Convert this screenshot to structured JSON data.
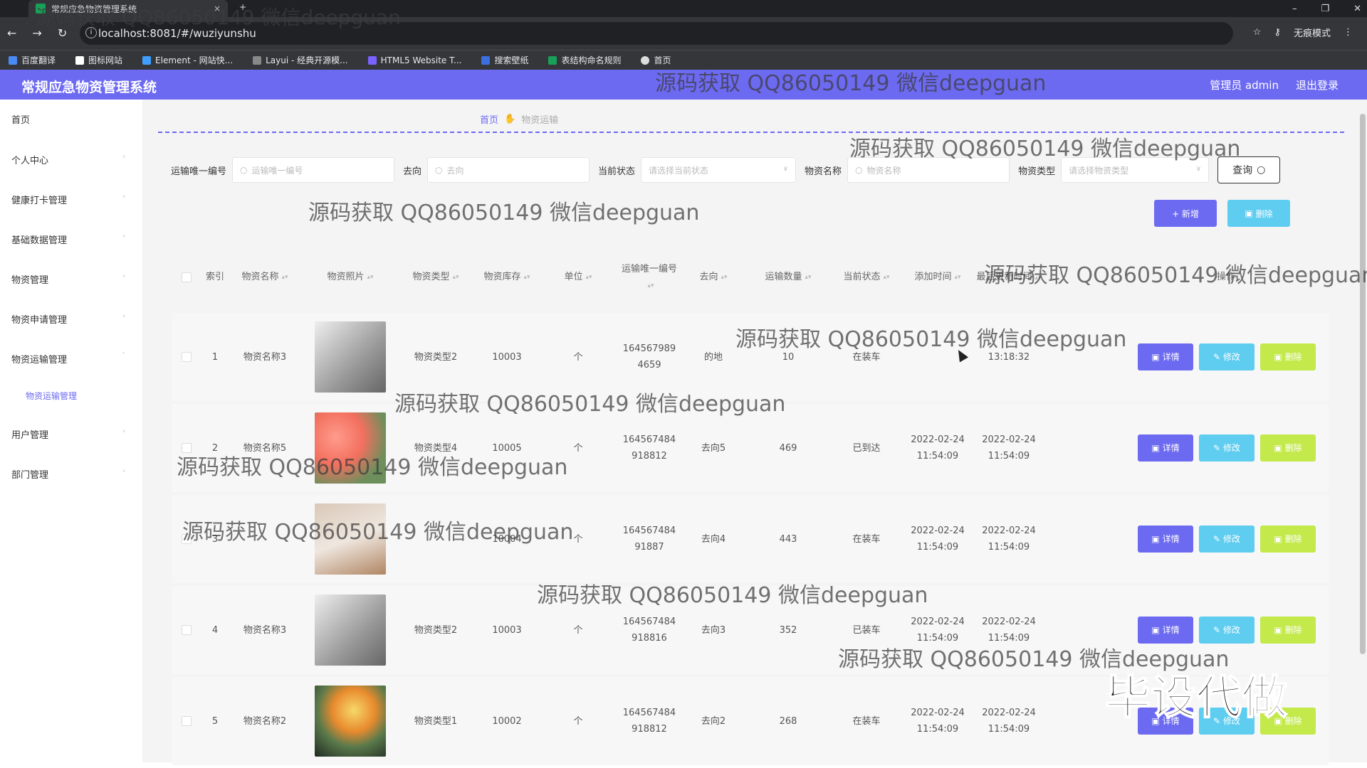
{
  "browser": {
    "tab_title": "常规应急物资管理系统",
    "tab_close": "×",
    "new_tab": "+",
    "url": "localhost:8081/#/wuziyunshu",
    "profile": "无痕模式",
    "bookmarks": [
      "百度翻译",
      "图标网站",
      "Element - 网站快...",
      "Layui - 经典开源模...",
      "HTML5 Website T...",
      "搜索壁纸",
      "表结构命名规则",
      "首页"
    ]
  },
  "header": {
    "title": "常规应急物资管理系统",
    "user": "管理员 admin",
    "logout": "退出登录"
  },
  "sidebar": {
    "items": [
      "首页",
      "个人中心",
      "健康打卡管理",
      "基础数据管理",
      "物资管理",
      "物资申请管理",
      "物资运输管理",
      "用户管理",
      "部门管理"
    ],
    "sub_item": "物资运输管理"
  },
  "breadcrumb": {
    "home": "首页",
    "current": "物资运输"
  },
  "filters": {
    "f1_label": "运输唯一编号",
    "f1_placeholder": "运输唯一编号",
    "f2_label": "去向",
    "f2_placeholder": "去向",
    "f3_label": "当前状态",
    "f3_placeholder": "请选择当前状态",
    "f4_label": "物资名称",
    "f4_placeholder": "物资名称",
    "f5_label": "物资类型",
    "f5_placeholder": "请选择物资类型",
    "query": "查询"
  },
  "actions": {
    "add": "+ 新增",
    "delete": "删除"
  },
  "table": {
    "headers": [
      "索引",
      "物资名称",
      "物资照片",
      "物资类型",
      "物资库存",
      "单位",
      "运输唯一编号",
      "去向",
      "运输数量",
      "当前状态",
      "添加时间",
      "最后更新时间",
      "操作"
    ],
    "row_buttons": {
      "detail": "详情",
      "edit": "修改",
      "delete": "删除"
    },
    "rows": [
      {
        "idx": "1",
        "name": "物资名称3",
        "type": "物资类型2",
        "stock": "10003",
        "unit": "个",
        "no": "164567989 4659",
        "dest": "的地",
        "qty": "10",
        "status": "在装车",
        "added": "",
        "updated": "13:18:32",
        "photo": "ph-1"
      },
      {
        "idx": "2",
        "name": "物资名称5",
        "type": "物资类型4",
        "stock": "10005",
        "unit": "个",
        "no": "164567484 918812",
        "dest": "去向5",
        "qty": "469",
        "status": "已到达",
        "added": "2022-02-24 11:54:09",
        "updated": "2022-02-24 11:54:09",
        "photo": "ph-2"
      },
      {
        "idx": "3",
        "name": "",
        "type": "",
        "stock": "10004",
        "unit": "个",
        "no": "164567484 91887",
        "dest": "去向4",
        "qty": "443",
        "status": "在装车",
        "added": "2022-02-24 11:54:09",
        "updated": "2022-02-24 11:54:09",
        "photo": "ph-3"
      },
      {
        "idx": "4",
        "name": "物资名称3",
        "type": "物资类型2",
        "stock": "10003",
        "unit": "个",
        "no": "164567484 918816",
        "dest": "去向3",
        "qty": "352",
        "status": "已装车",
        "added": "2022-02-24 11:54:09",
        "updated": "2022-02-24 11:54:09",
        "photo": "ph-1"
      },
      {
        "idx": "5",
        "name": "物资名称2",
        "type": "物资类型1",
        "stock": "10002",
        "unit": "个",
        "no": "164567484 918812",
        "dest": "去向2",
        "qty": "268",
        "status": "在装车",
        "added": "2022-02-24 11:54:09",
        "updated": "2022-02-24 11:54:09",
        "photo": "ph-4"
      }
    ]
  },
  "watermarks": {
    "text": "源码获取 QQ86050149 微信deepguan",
    "stamp": "毕设代做"
  }
}
